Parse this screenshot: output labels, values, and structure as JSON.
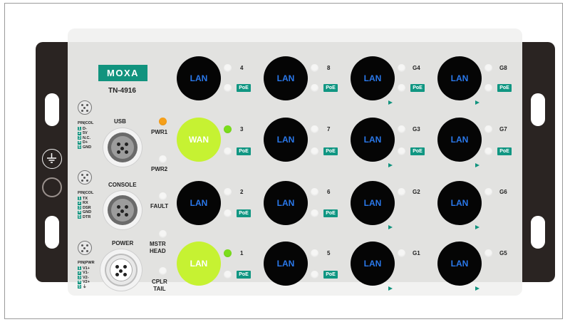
{
  "device": {
    "brand": "MOXA",
    "model": "TN-4916"
  },
  "connectors": {
    "usb": "USB",
    "console": "CONSOLE",
    "power": "POWER"
  },
  "pin_tables": {
    "usb": {
      "header": "PIN|COL",
      "rows": [
        {
          "n": "1",
          "s": "D-"
        },
        {
          "n": "2",
          "s": "5V"
        },
        {
          "n": "3",
          "s": "N.C."
        },
        {
          "n": "4",
          "s": "D+"
        },
        {
          "n": "5",
          "s": "GND"
        }
      ]
    },
    "console": {
      "header": "PIN|COL",
      "rows": [
        {
          "n": "1",
          "s": "TX"
        },
        {
          "n": "2",
          "s": "RX"
        },
        {
          "n": "3",
          "s": "DSR"
        },
        {
          "n": "4",
          "s": "GND"
        },
        {
          "n": "5",
          "s": "DTR"
        }
      ]
    },
    "power": {
      "header": "PIN|PWR",
      "rows": [
        {
          "n": "1",
          "s": "V1+"
        },
        {
          "n": "2",
          "s": "V1-"
        },
        {
          "n": "3",
          "s": "V2-"
        },
        {
          "n": "4",
          "s": "V2+"
        },
        {
          "n": "5",
          "s": "⏚"
        }
      ]
    }
  },
  "leds": {
    "pwr1": "PWR1",
    "pwr2": "PWR2",
    "fault": "FAULT",
    "mstr_head": "MSTR\nHEAD",
    "cplr_tail": "CPLR\nTAIL"
  },
  "poe_label": "PoE",
  "ports": {
    "p4": {
      "label": "LAN",
      "num": "4"
    },
    "p3": {
      "label": "WAN",
      "num": "3"
    },
    "p2": {
      "label": "LAN",
      "num": "2"
    },
    "p1": {
      "label": "LAN",
      "num": "1"
    },
    "p8": {
      "label": "LAN",
      "num": "8"
    },
    "p7": {
      "label": "LAN",
      "num": "7"
    },
    "p6": {
      "label": "LAN",
      "num": "6"
    },
    "p5": {
      "label": "LAN",
      "num": "5"
    },
    "g4": {
      "label": "LAN",
      "num": "G4"
    },
    "g3": {
      "label": "LAN",
      "num": "G3"
    },
    "g2": {
      "label": "LAN",
      "num": "G2"
    },
    "g1": {
      "label": "LAN",
      "num": "G1"
    },
    "g8": {
      "label": "LAN",
      "num": "G8"
    },
    "g7": {
      "label": "LAN",
      "num": "G7"
    },
    "g6": {
      "label": "LAN",
      "num": "G6"
    },
    "g5": {
      "label": "LAN",
      "num": "G5"
    }
  },
  "colors": {
    "brand_teal": "#11937e",
    "port_black": "#050505",
    "port_text_blue": "#2a78ea",
    "wan_lime": "#c6f232",
    "led_green": "#7bdd1c",
    "led_orange": "#f6a01a"
  }
}
